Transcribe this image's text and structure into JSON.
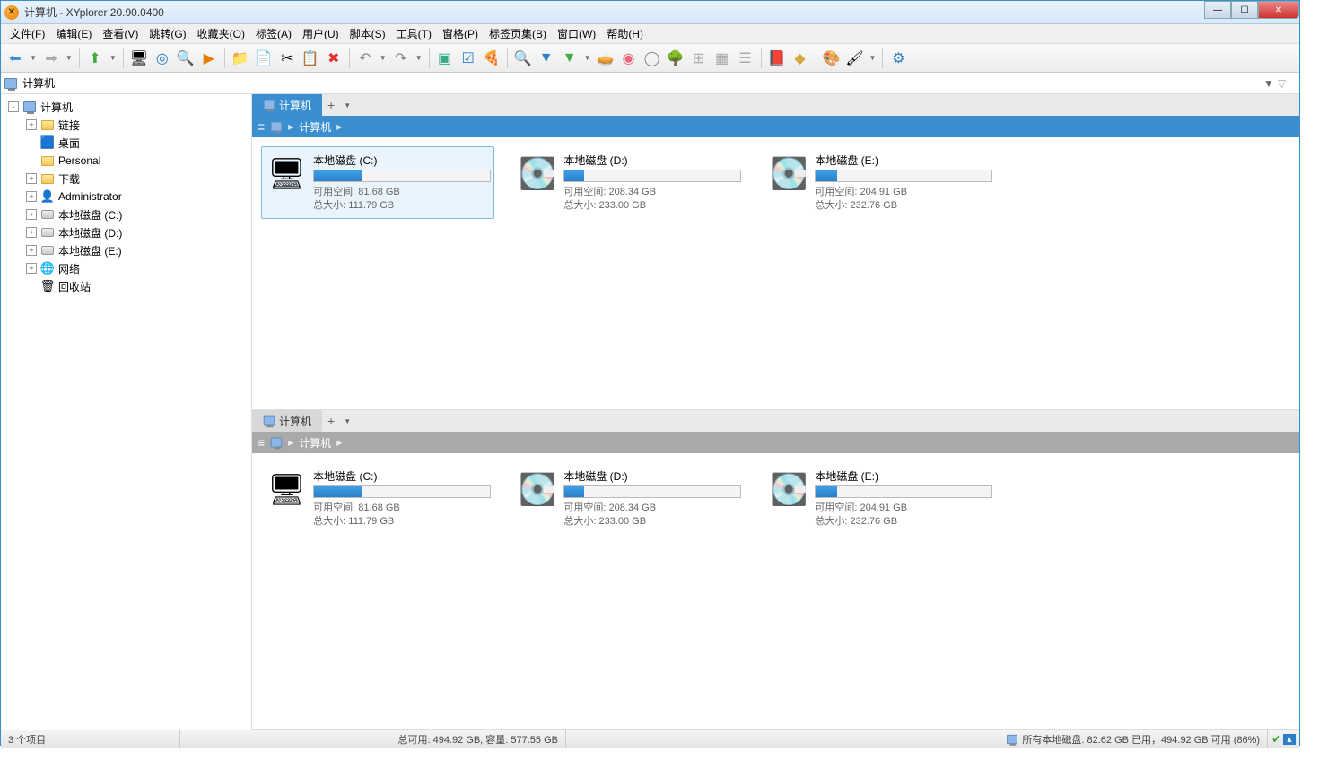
{
  "window": {
    "title": "计算机 - XYplorer 20.90.0400"
  },
  "menu": [
    "文件(F)",
    "编辑(E)",
    "查看(V)",
    "跳转(G)",
    "收藏夹(O)",
    "标签(A)",
    "用户(U)",
    "脚本(S)",
    "工具(T)",
    "窗格(P)",
    "标签页集(B)",
    "窗口(W)",
    "帮助(H)"
  ],
  "address": {
    "text": "计算机"
  },
  "tree": [
    {
      "indent": 0,
      "exp": "-",
      "icon": "comp",
      "label": "计算机"
    },
    {
      "indent": 1,
      "exp": "+",
      "icon": "folder",
      "label": "链接"
    },
    {
      "indent": 1,
      "exp": "",
      "icon": "desktop",
      "label": "桌面"
    },
    {
      "indent": 1,
      "exp": "",
      "icon": "folder",
      "label": "Personal"
    },
    {
      "indent": 1,
      "exp": "+",
      "icon": "folder",
      "label": "下载"
    },
    {
      "indent": 1,
      "exp": "+",
      "icon": "user",
      "label": "Administrator"
    },
    {
      "indent": 1,
      "exp": "+",
      "icon": "disk",
      "label": "本地磁盘 (C:)"
    },
    {
      "indent": 1,
      "exp": "+",
      "icon": "disk",
      "label": "本地磁盘 (D:)"
    },
    {
      "indent": 1,
      "exp": "+",
      "icon": "disk",
      "label": "本地磁盘 (E:)"
    },
    {
      "indent": 1,
      "exp": "+",
      "icon": "net",
      "label": "网络"
    },
    {
      "indent": 1,
      "exp": "",
      "icon": "bin",
      "label": "回收站"
    }
  ],
  "pane1": {
    "tab": "计算机",
    "crumb": "计算机",
    "drives": [
      {
        "name": "本地磁盘 (C:)",
        "free": "可用空间: 81.68 GB",
        "total": "总大小: 111.79 GB",
        "fill": 27,
        "selected": true,
        "sys": true
      },
      {
        "name": "本地磁盘 (D:)",
        "free": "可用空间: 208.34 GB",
        "total": "总大小: 233.00 GB",
        "fill": 11,
        "selected": false,
        "sys": false
      },
      {
        "name": "本地磁盘 (E:)",
        "free": "可用空间: 204.91 GB",
        "total": "总大小: 232.76 GB",
        "fill": 12,
        "selected": false,
        "sys": false
      }
    ]
  },
  "pane2": {
    "tab": "计算机",
    "crumb": "计算机",
    "drives": [
      {
        "name": "本地磁盘 (C:)",
        "free": "可用空间: 81.68 GB",
        "total": "总大小: 111.79 GB",
        "fill": 27,
        "selected": false,
        "sys": true
      },
      {
        "name": "本地磁盘 (D:)",
        "free": "可用空间: 208.34 GB",
        "total": "总大小: 233.00 GB",
        "fill": 11,
        "selected": false,
        "sys": false
      },
      {
        "name": "本地磁盘 (E:)",
        "free": "可用空间: 204.91 GB",
        "total": "总大小: 232.76 GB",
        "fill": 12,
        "selected": false,
        "sys": false
      }
    ]
  },
  "status": {
    "items": "3 个项目",
    "totals": "总可用: 494.92 GB, 容量: 577.55 GB",
    "disks": "所有本地磁盘: 82.62 GB 已用，494.92 GB 可用 (86%)"
  }
}
